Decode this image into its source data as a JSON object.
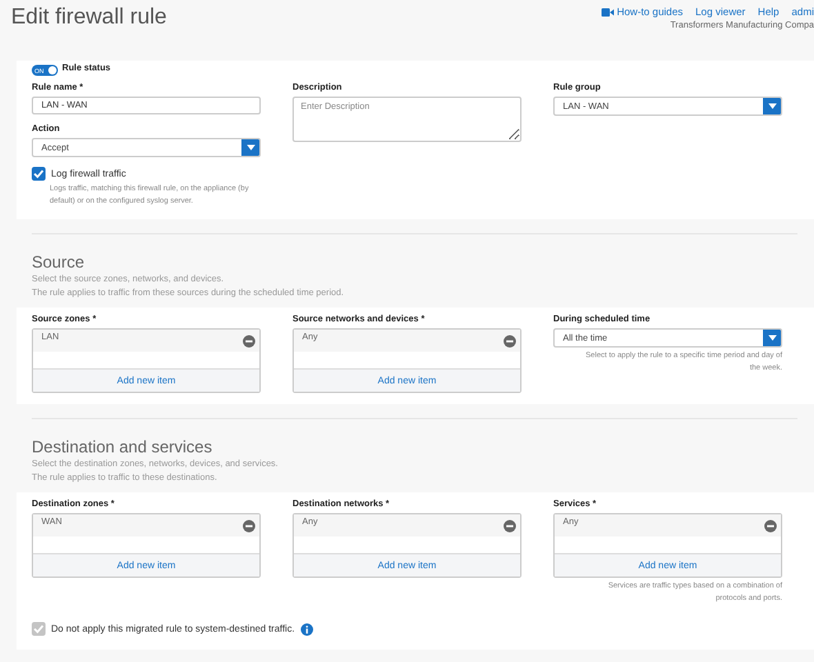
{
  "header": {
    "title": "Edit firewall rule",
    "links": [
      {
        "kind": "video",
        "label": "How-to guides"
      },
      {
        "kind": "plain",
        "label": "Log viewer"
      },
      {
        "kind": "plain",
        "label": "Help"
      },
      {
        "kind": "plain",
        "label": "admi"
      }
    ],
    "company": "Transformers Manufacturing Compa"
  },
  "general": {
    "rule_status": {
      "label": "Rule status",
      "on": true,
      "toggle_text": "ON"
    },
    "rule_name": {
      "label": "Rule name *",
      "value": "LAN - WAN"
    },
    "action": {
      "label": "Action",
      "value": "Accept"
    },
    "log_traffic": {
      "label": "Log firewall traffic",
      "checked": true,
      "help": "Logs traffic, matching this firewall rule, on the appliance (by default) or on the configured syslog server."
    },
    "description": {
      "label": "Description",
      "placeholder": "Enter Description"
    },
    "rule_group": {
      "label": "Rule group",
      "value": "LAN - WAN"
    }
  },
  "sections": [
    {
      "title": "Source",
      "lines": [
        "Select the source zones, networks, and devices.",
        "The rule applies to traffic from these sources during the scheduled time period."
      ],
      "fields": [
        {
          "kind": "list",
          "label": "Source zones *",
          "items": [
            "LAN"
          ],
          "add": "Add new item"
        },
        {
          "kind": "list",
          "label": "Source networks and devices *",
          "items": [
            "Any"
          ],
          "add": "Add new item"
        },
        {
          "kind": "select",
          "label": "During scheduled time",
          "value": "All the time",
          "help": "Select to apply the rule to a specific time period and day of the week."
        }
      ]
    },
    {
      "title": "Destination and services",
      "lines": [
        "Select the destination zones, networks, devices, and services.",
        "The rule applies to traffic to these destinations."
      ],
      "fields": [
        {
          "kind": "list",
          "label": "Destination zones *",
          "items": [
            "WAN"
          ],
          "add": "Add new item"
        },
        {
          "kind": "list",
          "label": "Destination networks *",
          "items": [
            "Any"
          ],
          "add": "Add new item"
        },
        {
          "kind": "list",
          "label": "Services *",
          "items": [
            "Any"
          ],
          "add": "Add new item",
          "help": "Services are traffic types based on a combination of protocols and ports."
        }
      ],
      "footer_check": {
        "label": "Do not apply this migrated rule to system-destined traffic.",
        "checked": true,
        "disabled": true
      }
    }
  ]
}
